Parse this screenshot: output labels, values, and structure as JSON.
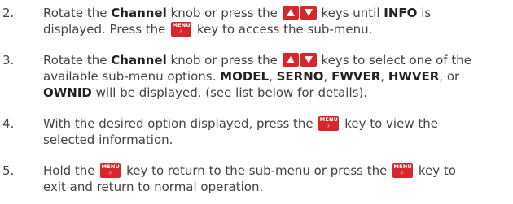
{
  "menu_key": {
    "top": "MENU",
    "bottom": "F"
  },
  "steps": [
    {
      "number": "2.",
      "t1": "Rotate the ",
      "b1": "Channel",
      "t2": " knob or press the ",
      "t3": " keys until ",
      "b2": "INFO",
      "t4": " is",
      "t5": "displayed. Press the ",
      "t6": " key to access the sub-menu."
    },
    {
      "number": "3.",
      "t1": "Rotate the ",
      "b1": "Channel",
      "t2": " knob or press the ",
      "t3": " keys to select one of the",
      "t4": "available sub-menu options. ",
      "b2": "MODEL",
      "c1": ", ",
      "b3": "SERNO",
      "c2": ", ",
      "b4": "FWVER",
      "c3": ", ",
      "b5": "HWVER",
      "t5": ", or",
      "b6": "OWNID",
      "t6": " will be displayed. (see list below for details)."
    },
    {
      "number": "4.",
      "t1": "With the desired option displayed, press the ",
      "t2": " key to view the",
      "t3": "selected information."
    },
    {
      "number": "5.",
      "t1": "Hold the ",
      "t2": " key to return to the sub-menu or press the ",
      "t3": " key to",
      "t4": "exit and return to normal operation."
    }
  ]
}
